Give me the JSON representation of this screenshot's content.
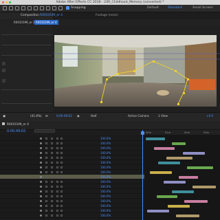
{
  "window": {
    "title": "Adobe After Effects CC 2018 - 24R_Childhood_Memory (converted) *"
  },
  "toolbar": {
    "snapping_label": "Snapping",
    "workspaces": [
      "Default",
      "Standard",
      "Small Screen"
    ],
    "active_workspace_index": 1
  },
  "composition_panel": {
    "tab_prefix": "Composition",
    "tab_name": "R0010199_er 4",
    "footage_label": "Footage (none)",
    "subtabs": [
      "R0010199_er 2",
      "R0010199_er 4"
    ],
    "active_subtab_index": 1
  },
  "viewer_footer": {
    "zoom": "(41.8%)",
    "timecode": "0:00:49:02",
    "resolution": "Half",
    "camera": "Active Camera",
    "views": "1 View",
    "exposure": "+0.0"
  },
  "timeline": {
    "tab_name": "R0010199_er 4",
    "current_time": "0:00:49:02",
    "ruler_labels": [
      "00m",
      "01m",
      "02m",
      "03m"
    ],
    "stretch_values": [
      "100.0%",
      "100.0%",
      "100.0%",
      "100.0%",
      "100.0%",
      "100.0%",
      "100.0%",
      "100.0%",
      "100.0%",
      "100.0%",
      "100.0%",
      "100.0%",
      "100.0%",
      "100.0%",
      "100.0%",
      "100.0%",
      "100.0%"
    ]
  },
  "colors": {
    "accent": "#4a90ff",
    "track_green": "#6aa84f",
    "track_teal": "#3f8f9a",
    "track_pink": "#c77fa0",
    "track_tan": "#b09a6a",
    "track_lavender": "#8f8fc4",
    "track_yellow": "#c9b04a"
  }
}
